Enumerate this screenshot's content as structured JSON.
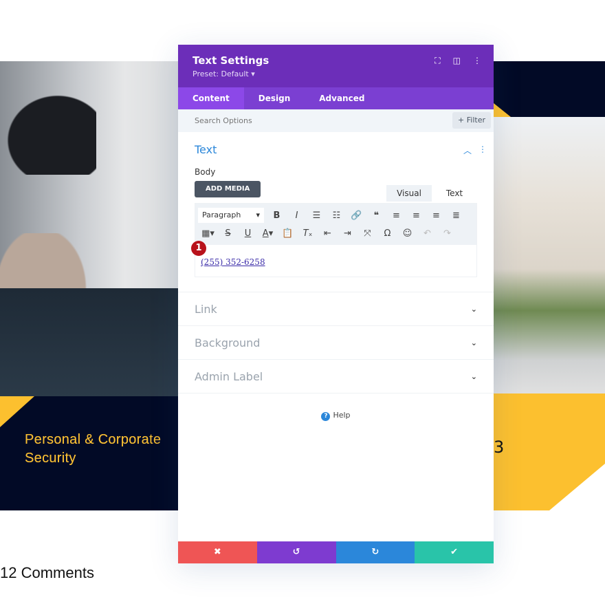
{
  "background": {
    "left_caption": "Personal & Corporate\nSecurity",
    "left_caption_line1": "Personal & Corpora",
    "left_caption_line2": "Security",
    "right_fragment": "3",
    "comments": "12 Comments",
    "colors": {
      "navy": "#020a26",
      "yellow": "#fcc02f"
    }
  },
  "panel": {
    "title": "Text Settings",
    "preset": "Preset: Default ▾",
    "header_icons": [
      "expand-icon",
      "columns-icon",
      "more-vertical-icon"
    ],
    "tabs": [
      {
        "label": "Content",
        "active": true
      },
      {
        "label": "Design"
      },
      {
        "label": "Advanced"
      }
    ],
    "search": {
      "placeholder": "Search Options",
      "filter_label": "+ Filter"
    },
    "text_section": {
      "title": "Text",
      "body_label": "Body",
      "add_media": "ADD MEDIA",
      "mode_tabs": [
        "Visual",
        "Text"
      ],
      "format_select": "Paragraph",
      "content": "(255) 352-6258",
      "badge": "1"
    },
    "sections": [
      "Link",
      "Background",
      "Admin Label"
    ],
    "help": "Help",
    "footer": {
      "colors": {
        "cancel": "#ef5555",
        "undo": "#7e3bd0",
        "redo": "#2b87da",
        "save": "#29c4a9"
      }
    },
    "colors": {
      "header": "#6c2eb9",
      "tabs": "#7b3fd2",
      "accent": "#2b87da"
    }
  }
}
